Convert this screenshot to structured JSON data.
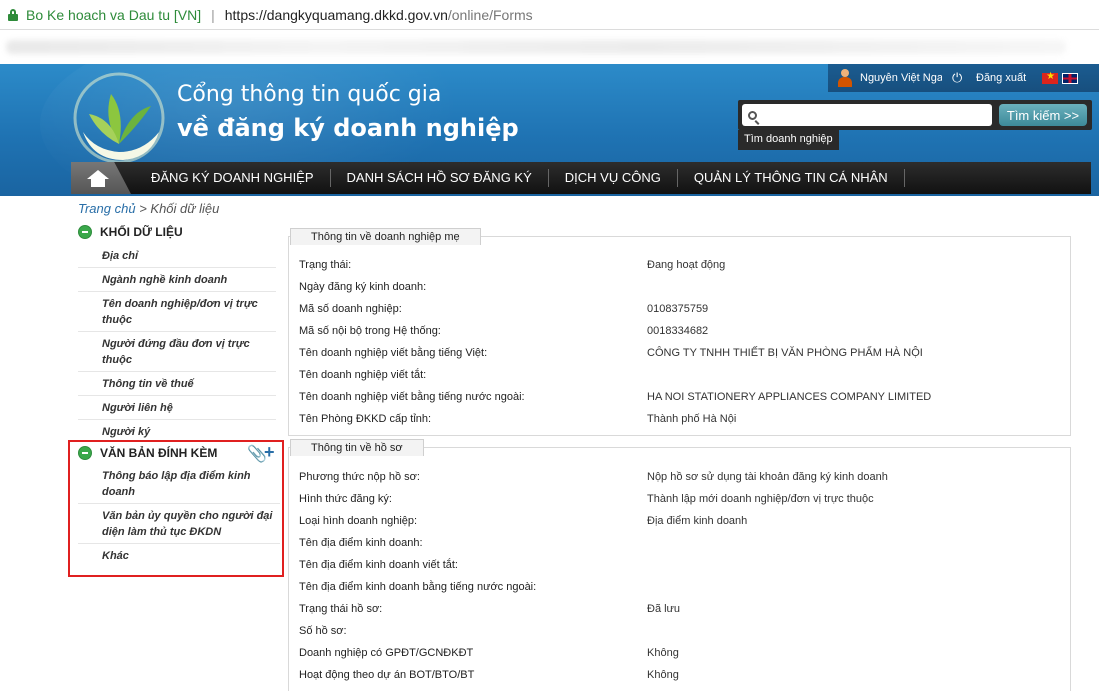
{
  "browser": {
    "site_name": "Bo Ke hoach va Dau tu [VN]",
    "url_host": "https://dangkyquamang.dkkd.gov.vn",
    "url_path": "/online/Forms"
  },
  "header": {
    "title_line1": "Cổng thông tin quốc gia",
    "title_line2": "về đăng ký doanh nghiệp",
    "user_name": "Nguyễn Việt Nga",
    "logout": "Đăng xuất",
    "search_placeholder": "",
    "search_button": "Tìm kiếm >>",
    "find_business": "Tìm doanh nghiệp"
  },
  "nav": {
    "items": [
      "ĐĂNG KÝ DOANH NGHIỆP",
      "DANH SÁCH HỒ SƠ ĐĂNG KÝ",
      "DỊCH VỤ CÔNG",
      "QUẢN LÝ THÔNG TIN CÁ NHÂN"
    ]
  },
  "breadcrumb": {
    "link": "Trang chủ",
    "separator": " > ",
    "current": "Khối dữ liệu"
  },
  "sidebar": {
    "data_block_title": "KHỐI DỮ LIỆU",
    "data_items": [
      "Địa chỉ",
      "Ngành nghề kinh doanh",
      "Tên doanh nghiệp/đơn vị trực thuộc",
      "Người đứng đầu đơn vị trực thuộc",
      "Thông tin về thuế",
      "Người liên hệ",
      "Người ký"
    ],
    "attachments_title": "VĂN BẢN ĐÍNH KÈM",
    "attachment_items": [
      "Thông báo lập địa điểm kinh doanh",
      "Văn bản ủy quyền cho người đại diện làm thủ tục ĐKDN",
      "Khác"
    ]
  },
  "parent_panel": {
    "title": "Thông tin về doanh nghiệp mẹ",
    "rows": [
      {
        "label": "Trạng thái:",
        "value": "Đang hoạt động"
      },
      {
        "label": "Ngày đăng ký kinh doanh:",
        "value": ""
      },
      {
        "label": "Mã số doanh nghiệp:",
        "value": "0108375759"
      },
      {
        "label": "Mã số nội bộ trong Hệ thống:",
        "value": "0018334682"
      },
      {
        "label": "Tên doanh nghiệp viết bằng tiếng Việt:",
        "value": "CÔNG TY TNHH THIẾT BỊ VĂN PHÒNG PHẨM HÀ NỘI"
      },
      {
        "label": "Tên doanh nghiệp viết tắt:",
        "value": ""
      },
      {
        "label": "Tên doanh nghiệp viết bằng tiếng nước ngoài:",
        "value": "HA NOI STATIONERY APPLIANCES COMPANY LIMITED"
      },
      {
        "label": "Tên Phòng ĐKKD cấp tỉnh:",
        "value": "Thành phố Hà Nội"
      }
    ]
  },
  "dossier_panel": {
    "title": "Thông tin về hồ sơ",
    "rows": [
      {
        "label": "Phương thức nộp hồ sơ:",
        "value": "Nộp hồ sơ sử dụng tài khoản đăng ký kinh doanh"
      },
      {
        "label": "Hình thức đăng ký:",
        "value": "Thành lập mới doanh nghiệp/đơn vị trực thuộc"
      },
      {
        "label": "Loại hình doanh nghiệp:",
        "value": "Địa điểm kinh doanh"
      },
      {
        "label": "Tên địa điểm kinh doanh:",
        "value": ""
      },
      {
        "label": "Tên địa điểm kinh doanh viết tắt:",
        "value": ""
      },
      {
        "label": "Tên địa điểm kinh doanh bằng tiếng nước ngoài:",
        "value": ""
      },
      {
        "label": "Trạng thái hồ sơ:",
        "value": "Đã lưu"
      },
      {
        "label": "Số hồ sơ:",
        "value": ""
      },
      {
        "label": "Doanh nghiệp có GPĐT/GCNĐKĐT",
        "value": "Không"
      },
      {
        "label": "Hoạt động theo dự án BOT/BTO/BT",
        "value": "Không"
      }
    ]
  }
}
